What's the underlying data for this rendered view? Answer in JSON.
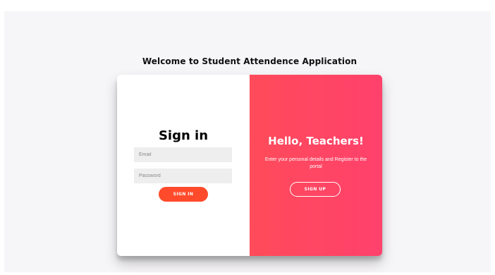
{
  "page": {
    "welcome_title": "Welcome to Student Attendence Application"
  },
  "signin": {
    "title": "Sign in",
    "email_placeholder": "Email",
    "password_placeholder": "Password",
    "button_label": "SIGN IN"
  },
  "overlay": {
    "title": "Hello, Teachers!",
    "text": "Enter your personal details and Register to the portal",
    "button_label": "SIGN UP"
  },
  "colors": {
    "page_background": "#f6f5f7",
    "signin_button": "#ff4b2b",
    "overlay_gradient_start": "#ff4b5a",
    "overlay_gradient_end": "#ff416c"
  }
}
